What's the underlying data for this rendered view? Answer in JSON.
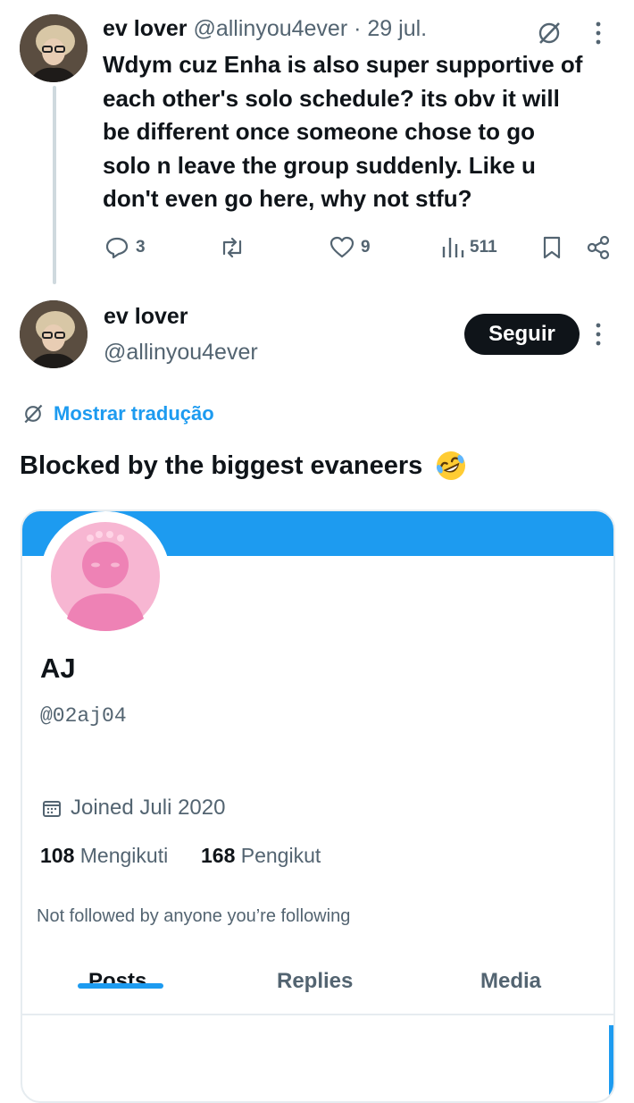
{
  "reply": {
    "display_name": "ev lover",
    "handle": "@allinyou4ever",
    "separator": "·",
    "date": "29 jul.",
    "text": "Wdym cuz Enha is also super supportive of each other's solo schedule? its obv it will be different once someone chose to go solo n leave the group suddenly. Like u don't even go here, why not stfu?",
    "lines": [
      "Wdym cuz Enha is also super supportive of",
      "each other's solo schedule? its obv it will",
      "be different once someone chose to go",
      "solo n leave the group suddenly. Like u",
      "don't even go here, why not stfu?"
    ],
    "actions": {
      "replies": "3",
      "retweets": "",
      "likes": "9",
      "views": "511"
    }
  },
  "main_tweet": {
    "display_name": "ev lover",
    "handle": "@allinyou4ever",
    "follow_label": "Seguir",
    "translate_label": "Mostrar tradução",
    "text": "Blocked by the biggest evaneers",
    "emoji": "🤣"
  },
  "embedded_profile": {
    "name": "AJ",
    "handle": "@02aj04",
    "joined": "Joined Juli 2020",
    "following_count": "108",
    "following_label": "Mengikuti",
    "followers_count": "168",
    "followers_label": "Pengikut",
    "followed_by_note": "Not followed by anyone you’re following",
    "tabs": [
      "Posts",
      "Replies",
      "Media"
    ],
    "active_tab": "Posts"
  },
  "colors": {
    "accent": "#1d9bf0",
    "text": "#0f1419",
    "muted": "#536471",
    "avatar_pink": "#f49ac1"
  },
  "icons": [
    "grok-icon",
    "more-icon",
    "reply-icon",
    "retweet-icon",
    "like-icon",
    "views-icon",
    "bookmark-icon",
    "share-icon",
    "translate-icon",
    "calendar-icon"
  ]
}
